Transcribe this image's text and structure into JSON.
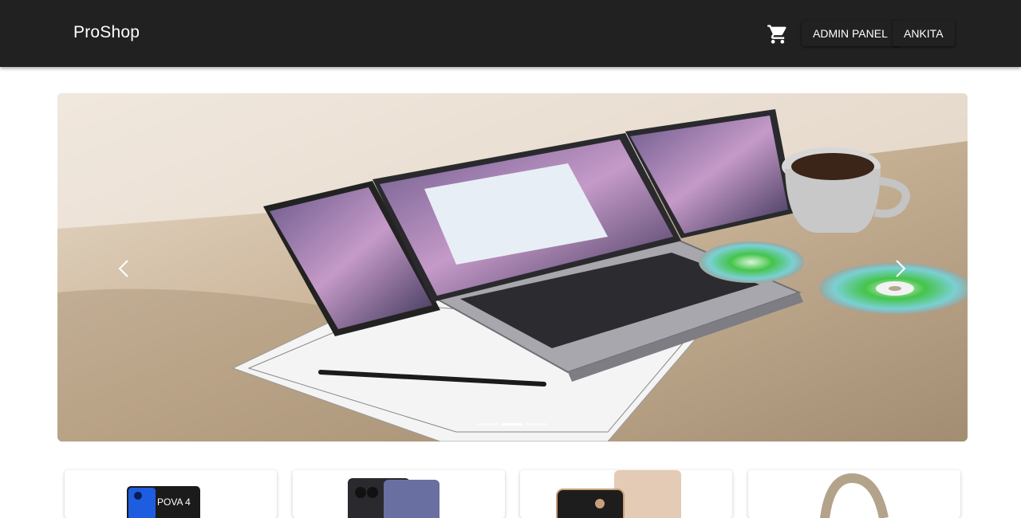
{
  "header": {
    "brand": "ProShop",
    "admin_label": "ADMIN PANEL",
    "user_label": "ANKITA"
  },
  "icons": {
    "cart": "shopping-cart-icon",
    "prev": "chevron-left-icon",
    "next": "chevron-right-icon"
  },
  "carousel": {
    "slide_count": 3,
    "active_index": 1
  },
  "products": [
    {
      "image_text": "POVA 4"
    },
    {
      "image_text": ""
    },
    {
      "image_text": ""
    },
    {
      "image_text": ""
    }
  ]
}
